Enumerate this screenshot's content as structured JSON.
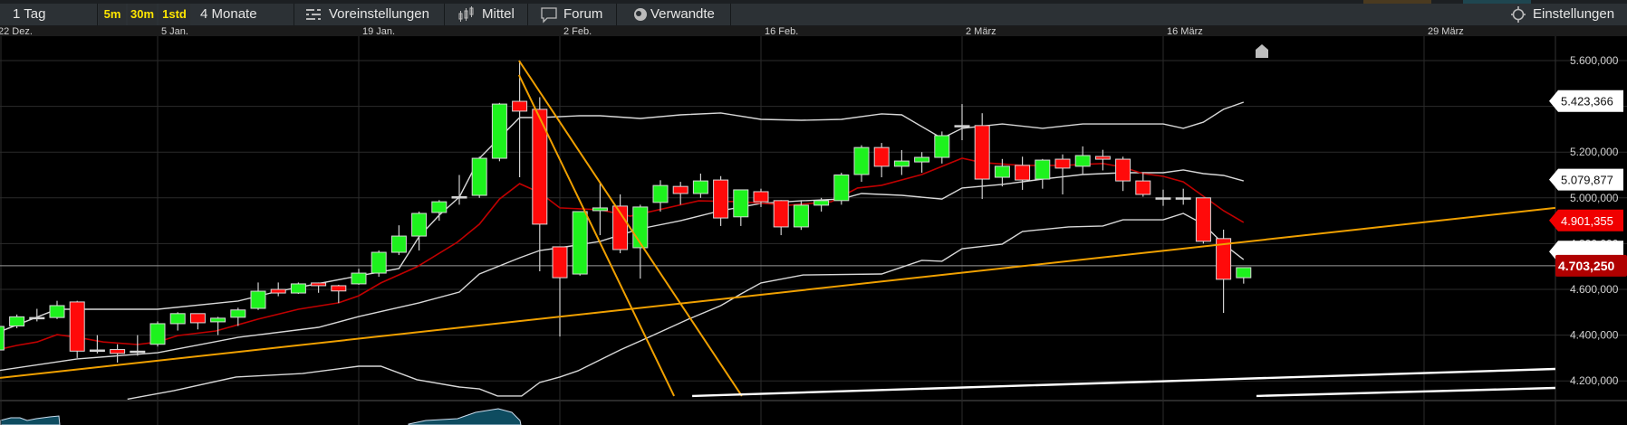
{
  "toolbar": {
    "period": "1 Tag",
    "intervals": [
      "5m",
      "30m",
      "1std"
    ],
    "range": "4 Monate",
    "presets": "Voreinstellungen",
    "indicators": "Mittel",
    "forum": "Forum",
    "related": "Verwandte",
    "settings": "Einstellungen",
    "icons": {
      "presets": "sliders-icon",
      "indicators": "candles-icon",
      "forum": "speech-bubble-icon",
      "related": "eye-icon",
      "settings": "gear-icon"
    },
    "accent": "#ffe600"
  },
  "chart_data": {
    "type": "candlestick",
    "x_ticks": [
      {
        "label": "22 Dez.",
        "bar": 0
      },
      {
        "label": "5 Jan.",
        "bar": 8
      },
      {
        "label": "19 Jan.",
        "bar": 18
      },
      {
        "label": "2 Feb.",
        "bar": 28
      },
      {
        "label": "16 Feb.",
        "bar": 38
      },
      {
        "label": "2 März",
        "bar": 48
      },
      {
        "label": "16 März",
        "bar": 58
      },
      {
        "label": "29 März",
        "bar": 71
      }
    ],
    "y_ticks": [
      "5.600,000",
      "5.400,000",
      "5.200,000",
      "5.000,000",
      "4.800,000",
      "4.600,000",
      "4.400,000",
      "4.200,000"
    ],
    "y_tick_values": [
      5.6,
      5.4,
      5.2,
      5.0,
      4.8,
      4.6,
      4.4,
      4.2
    ],
    "ylim": [
      4.134,
      5.72
    ],
    "xlim_bars": [
      0,
      77.5
    ],
    "grid": true,
    "colors": {
      "up": "#1df21d",
      "down": "#ff0a0a",
      "wick": "#cfcfcf",
      "ma": "#c00000",
      "band": "#d8d8d8",
      "trend": "#f0a000",
      "support": "#ffffff"
    },
    "candles": [
      [
        4.335,
        4.45,
        4.32,
        4.438
      ],
      [
        4.44,
        4.49,
        4.43,
        4.48
      ],
      [
        4.477,
        4.515,
        4.46,
        4.477
      ],
      [
        4.477,
        4.55,
        4.47,
        4.529
      ],
      [
        4.545,
        4.55,
        4.3,
        4.33
      ],
      [
        4.335,
        4.4,
        4.32,
        4.335
      ],
      [
        4.337,
        4.36,
        4.28,
        4.32
      ],
      [
        4.33,
        4.4,
        4.31,
        4.33
      ],
      [
        4.36,
        4.46,
        4.35,
        4.45
      ],
      [
        4.45,
        4.5,
        4.42,
        4.494
      ],
      [
        4.494,
        4.494,
        4.425,
        4.454
      ],
      [
        4.458,
        4.48,
        4.4,
        4.474
      ],
      [
        4.478,
        4.52,
        4.44,
        4.51
      ],
      [
        4.517,
        4.63,
        4.51,
        4.592
      ],
      [
        4.6,
        4.63,
        4.57,
        4.584
      ],
      [
        4.584,
        4.63,
        4.58,
        4.624
      ],
      [
        4.628,
        4.63,
        4.585,
        4.616
      ],
      [
        4.616,
        4.62,
        4.54,
        4.593
      ],
      [
        4.624,
        4.69,
        4.62,
        4.671
      ],
      [
        4.671,
        4.77,
        4.655,
        4.762
      ],
      [
        4.762,
        4.88,
        4.75,
        4.833
      ],
      [
        4.833,
        4.94,
        4.77,
        4.932
      ],
      [
        4.936,
        4.99,
        4.9,
        4.983
      ],
      [
        5.005,
        5.1,
        4.97,
        5.005
      ],
      [
        5.011,
        5.18,
        5.0,
        5.173
      ],
      [
        5.173,
        5.415,
        5.16,
        5.41
      ],
      [
        5.422,
        5.6,
        5.09,
        5.379
      ],
      [
        5.387,
        5.44,
        4.679,
        4.885
      ],
      [
        4.786,
        4.786,
        4.394,
        4.651
      ],
      [
        4.667,
        4.94,
        4.66,
        4.94
      ],
      [
        4.944,
        5.066,
        4.837,
        4.956
      ],
      [
        4.964,
        5.015,
        4.758,
        4.774
      ],
      [
        4.782,
        4.97,
        4.647,
        4.96
      ],
      [
        4.98,
        5.077,
        4.94,
        5.054
      ],
      [
        5.05,
        5.07,
        4.97,
        5.019
      ],
      [
        5.019,
        5.106,
        5.0,
        5.074
      ],
      [
        5.078,
        5.095,
        4.877,
        4.912
      ],
      [
        4.917,
        5.035,
        4.877,
        5.035
      ],
      [
        5.027,
        5.04,
        4.96,
        4.983
      ],
      [
        4.988,
        4.99,
        4.837,
        4.873
      ],
      [
        4.873,
        4.99,
        4.86,
        4.968
      ],
      [
        4.968,
        5.0,
        4.94,
        4.988
      ],
      [
        4.988,
        5.11,
        4.97,
        5.1
      ],
      [
        5.102,
        5.23,
        5.07,
        5.22
      ],
      [
        5.22,
        5.24,
        5.09,
        5.138
      ],
      [
        5.138,
        5.209,
        5.1,
        5.161
      ],
      [
        5.157,
        5.2,
        5.11,
        5.177
      ],
      [
        5.177,
        5.29,
        5.15,
        5.272
      ],
      [
        5.316,
        5.41,
        5.252,
        5.316
      ],
      [
        5.316,
        5.37,
        4.995,
        5.082
      ],
      [
        5.09,
        5.17,
        5.05,
        5.138
      ],
      [
        5.142,
        5.18,
        5.035,
        5.078
      ],
      [
        5.082,
        5.17,
        5.04,
        5.165
      ],
      [
        5.169,
        5.19,
        5.015,
        5.13
      ],
      [
        5.138,
        5.225,
        5.1,
        5.185
      ],
      [
        5.181,
        5.21,
        5.12,
        5.169
      ],
      [
        5.169,
        5.18,
        5.03,
        5.074
      ],
      [
        5.074,
        5.11,
        5.005,
        5.015
      ],
      [
        5.0,
        5.036,
        4.965,
        5.0
      ],
      [
        5.0,
        5.04,
        4.97,
        5.0
      ],
      [
        5.0,
        5.0,
        4.8,
        4.81
      ],
      [
        4.822,
        4.861,
        4.497,
        4.644
      ],
      [
        4.651,
        4.695,
        4.625,
        4.695
      ]
    ],
    "upper_band": [
      [
        0,
        4.41
      ],
      [
        3,
        4.513
      ],
      [
        8,
        4.513
      ],
      [
        12,
        4.549
      ],
      [
        14,
        4.592
      ],
      [
        18,
        4.659
      ],
      [
        20,
        4.691
      ],
      [
        21,
        4.83
      ],
      [
        22,
        4.924
      ],
      [
        23,
        5.003
      ],
      [
        24,
        5.173
      ],
      [
        26,
        5.351
      ],
      [
        27,
        5.351
      ],
      [
        29,
        5.359
      ],
      [
        30,
        5.359
      ],
      [
        32,
        5.347
      ],
      [
        34,
        5.363
      ],
      [
        36,
        5.371
      ],
      [
        38,
        5.343
      ],
      [
        40,
        5.339
      ],
      [
        42,
        5.343
      ],
      [
        44,
        5.367
      ],
      [
        45,
        5.363
      ],
      [
        47,
        5.26
      ],
      [
        48,
        5.304
      ],
      [
        50,
        5.323
      ],
      [
        52,
        5.304
      ],
      [
        54,
        5.323
      ],
      [
        56,
        5.323
      ],
      [
        58,
        5.323
      ],
      [
        59,
        5.304
      ],
      [
        60,
        5.331
      ],
      [
        61,
        5.387
      ],
      [
        62,
        5.418
      ]
    ],
    "middle_band": [
      [
        0,
        4.244
      ],
      [
        4,
        4.296
      ],
      [
        8,
        4.323
      ],
      [
        12,
        4.39
      ],
      [
        16,
        4.434
      ],
      [
        18,
        4.481
      ],
      [
        21,
        4.541
      ],
      [
        23,
        4.588
      ],
      [
        24,
        4.667
      ],
      [
        26,
        4.738
      ],
      [
        27,
        4.77
      ],
      [
        28,
        4.782
      ],
      [
        30,
        4.81
      ],
      [
        32,
        4.865
      ],
      [
        34,
        4.9
      ],
      [
        36,
        4.944
      ],
      [
        38,
        4.976
      ],
      [
        40,
        4.987
      ],
      [
        42,
        4.995
      ],
      [
        43,
        5.019
      ],
      [
        45,
        5.011
      ],
      [
        47,
        4.995
      ],
      [
        48,
        5.043
      ],
      [
        50,
        5.059
      ],
      [
        52,
        5.082
      ],
      [
        54,
        5.102
      ],
      [
        56,
        5.11
      ],
      [
        58,
        5.11
      ],
      [
        59,
        5.122
      ],
      [
        60,
        5.106
      ],
      [
        61,
        5.098
      ],
      [
        62,
        5.074
      ]
    ],
    "lower_band": [
      [
        6.5,
        4.12
      ],
      [
        8.8,
        4.157
      ],
      [
        11.9,
        4.217
      ],
      [
        15.2,
        4.232
      ],
      [
        18,
        4.264
      ],
      [
        19.1,
        4.264
      ],
      [
        20.9,
        4.205
      ],
      [
        23,
        4.173
      ],
      [
        24,
        4.165
      ],
      [
        24.9,
        4.134
      ],
      [
        26.1,
        4.134
      ],
      [
        27,
        4.193
      ],
      [
        28,
        4.217
      ],
      [
        28.9,
        4.244
      ],
      [
        31,
        4.335
      ],
      [
        32.4,
        4.39
      ],
      [
        34.4,
        4.47
      ],
      [
        36,
        4.529
      ],
      [
        37,
        4.58
      ],
      [
        38,
        4.628
      ],
      [
        40.1,
        4.663
      ],
      [
        44,
        4.667
      ],
      [
        46,
        4.727
      ],
      [
        47,
        4.723
      ],
      [
        48,
        4.778
      ],
      [
        50,
        4.798
      ],
      [
        51,
        4.853
      ],
      [
        53.3,
        4.873
      ],
      [
        55,
        4.877
      ],
      [
        56,
        4.904
      ],
      [
        58,
        4.904
      ],
      [
        59,
        4.932
      ],
      [
        60,
        4.885
      ],
      [
        61,
        4.798
      ],
      [
        62,
        4.73
      ]
    ],
    "moving_average": [
      [
        0,
        4.335
      ],
      [
        1,
        4.355
      ],
      [
        2,
        4.37
      ],
      [
        3,
        4.402
      ],
      [
        4,
        4.39
      ],
      [
        5.3,
        4.37
      ],
      [
        7,
        4.359
      ],
      [
        8,
        4.37
      ],
      [
        9,
        4.398
      ],
      [
        10.9,
        4.418
      ],
      [
        13,
        4.47
      ],
      [
        15,
        4.513
      ],
      [
        17,
        4.541
      ],
      [
        18,
        4.572
      ],
      [
        19.1,
        4.628
      ],
      [
        20.9,
        4.699
      ],
      [
        22.9,
        4.806
      ],
      [
        24,
        4.885
      ],
      [
        25,
        4.995
      ],
      [
        26,
        5.062
      ],
      [
        27,
        5.023
      ],
      [
        28,
        4.956
      ],
      [
        30,
        4.948
      ],
      [
        31.5,
        4.92
      ],
      [
        34.9,
        4.987
      ],
      [
        37,
        4.983
      ],
      [
        39.4,
        4.968
      ],
      [
        41.5,
        4.983
      ],
      [
        42.8,
        5.043
      ],
      [
        44,
        5.055
      ],
      [
        46,
        5.102
      ],
      [
        48,
        5.173
      ],
      [
        49,
        5.154
      ],
      [
        51,
        5.142
      ],
      [
        53,
        5.142
      ],
      [
        55,
        5.15
      ],
      [
        56,
        5.134
      ],
      [
        57,
        5.106
      ],
      [
        58,
        5.094
      ],
      [
        59,
        5.07
      ],
      [
        60,
        5.007
      ],
      [
        61,
        4.944
      ],
      [
        62,
        4.893
      ]
    ],
    "trend_lines": [
      [
        [
          0.16,
          4.213
        ],
        [
          77.5,
          4.956
        ]
      ],
      [
        [
          25.97,
          5.6
        ],
        [
          37.05,
          4.134
        ]
      ],
      [
        [
          25.97,
          5.537
        ],
        [
          33.68,
          4.134
        ]
      ]
    ],
    "support_lines": [
      [
        [
          34.58,
          4.134
        ],
        [
          77.5,
          4.252
        ]
      ],
      [
        [
          62.64,
          4.134
        ],
        [
          77.5,
          4.169
        ]
      ]
    ],
    "last_price": 4.70325,
    "badges": [
      {
        "value": 5.423366,
        "label": "5.423,366",
        "style": "white"
      },
      {
        "value": 5.079877,
        "label": "5.079,877",
        "style": "white"
      },
      {
        "value": 4.901355,
        "label": "4.901,355",
        "style": "red"
      },
      {
        "value": 4.765,
        "label": "",
        "style": "white"
      },
      {
        "value": 4.70325,
        "label": "4.703,250",
        "style": "darkred"
      }
    ]
  }
}
